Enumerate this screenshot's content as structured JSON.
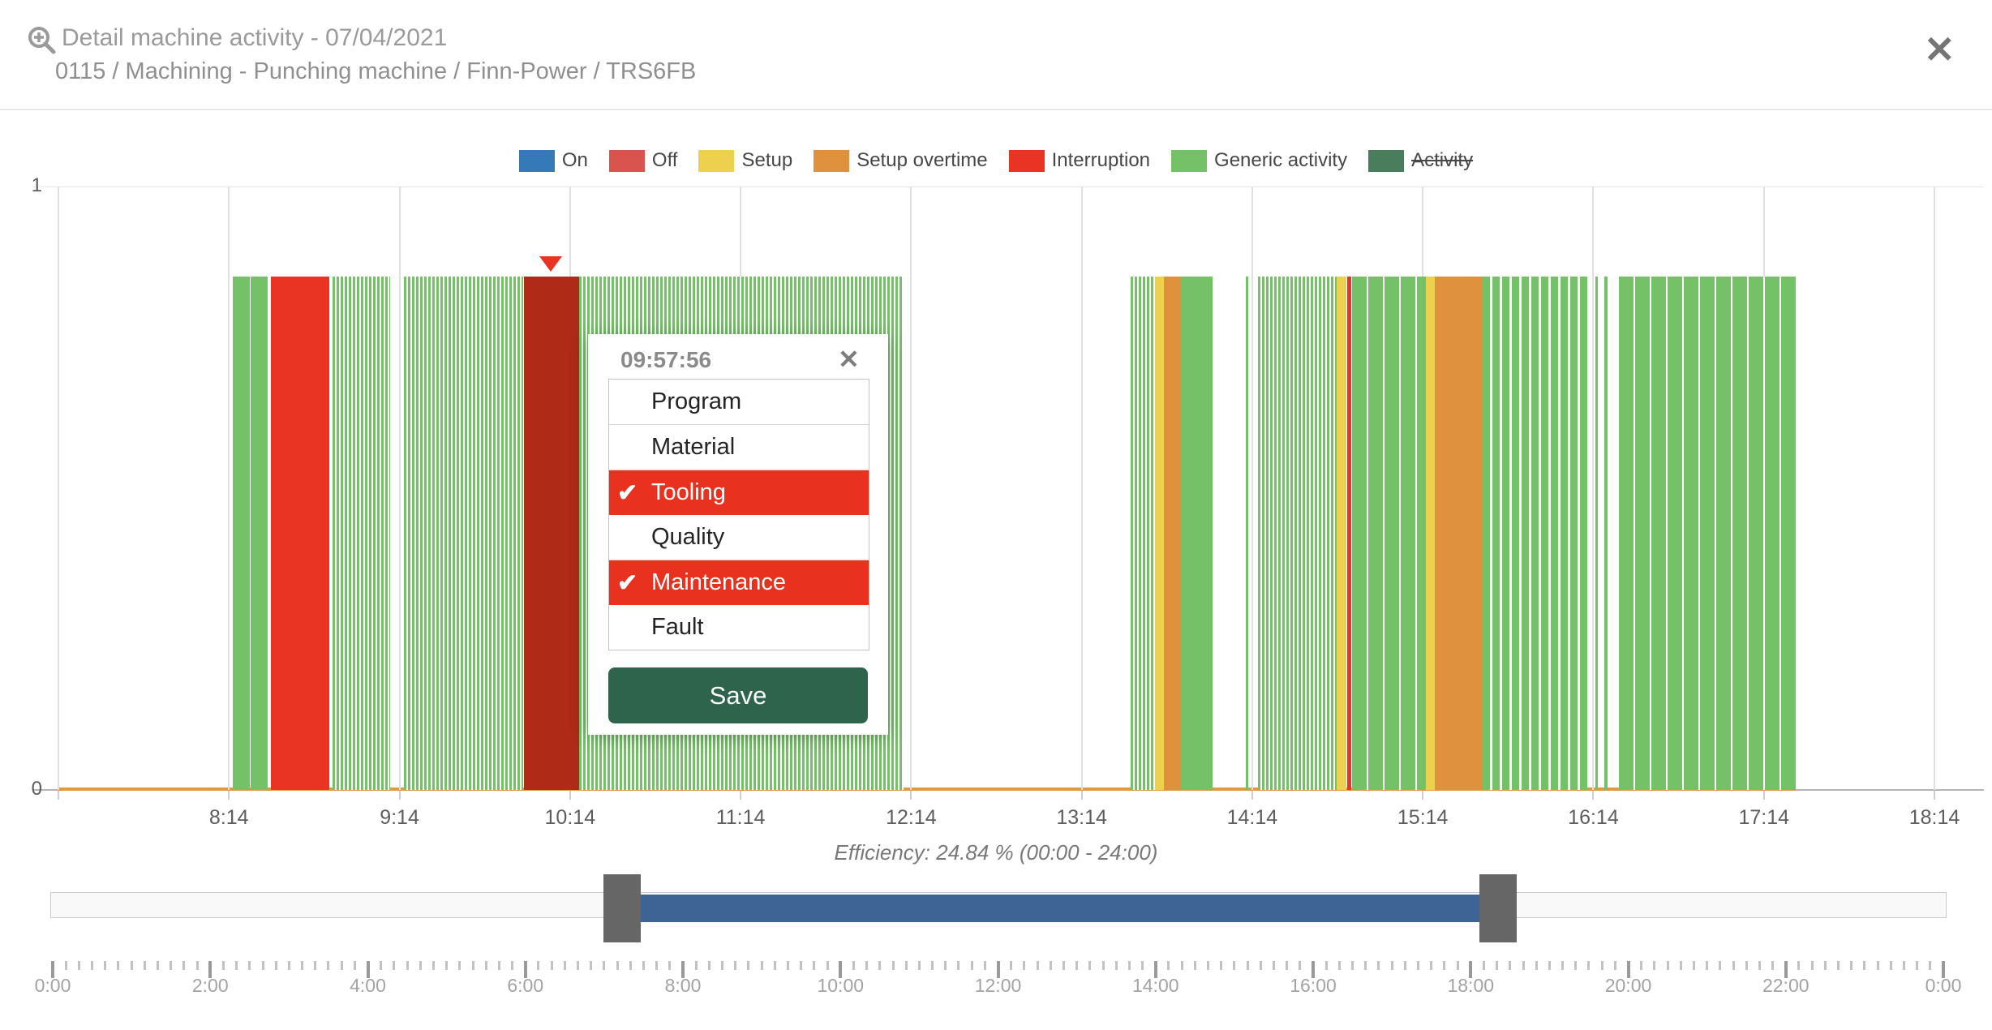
{
  "header": {
    "title": "Detail machine activity - 07/04/2021",
    "subtitle": "0115 / Machining - Punching machine / Finn-Power / TRS6FB",
    "close_glyph": "✕"
  },
  "legend": {
    "items": [
      {
        "label": "On",
        "color": "#3579b8",
        "struck": false
      },
      {
        "label": "Off",
        "color": "#d9534f",
        "struck": false
      },
      {
        "label": "Setup",
        "color": "#ecd04e",
        "struck": false
      },
      {
        "label": "Setup overtime",
        "color": "#e0913d",
        "struck": false
      },
      {
        "label": "Interruption",
        "color": "#e93323",
        "struck": false
      },
      {
        "label": "Generic activity",
        "color": "#74c167",
        "struck": false
      },
      {
        "label": "Activity",
        "color": "#4a7d5c",
        "struck": true
      }
    ]
  },
  "chart_data": {
    "type": "bar",
    "variant": "machine-activity-timeline",
    "title": "Detail machine activity - 07/04/2021",
    "x_start_hours": 7.2333,
    "x_end_hours": 18.2333,
    "x_ticks": [
      {
        "hours": 8.2333,
        "label": "8:14"
      },
      {
        "hours": 9.2333,
        "label": "9:14"
      },
      {
        "hours": 10.2333,
        "label": "10:14"
      },
      {
        "hours": 11.2333,
        "label": "11:14"
      },
      {
        "hours": 12.2333,
        "label": "12:14"
      },
      {
        "hours": 13.2333,
        "label": "13:14"
      },
      {
        "hours": 14.2333,
        "label": "14:14"
      },
      {
        "hours": 15.2333,
        "label": "15:14"
      },
      {
        "hours": 16.2333,
        "label": "16:14"
      },
      {
        "hours": 17.2333,
        "label": "17:14"
      },
      {
        "hours": 18.2333,
        "label": "18:14"
      }
    ],
    "y_ticks": [
      {
        "value": 1,
        "label": "1"
      },
      {
        "value": 0,
        "label": "0"
      }
    ],
    "bar_value": 0.85,
    "efficiency_caption": "Efficiency: 24.84 % (00:00 - 24:00)",
    "state_colors": {
      "on": "#3579b8",
      "off": "#d9534f",
      "setup": "#ecd04e",
      "setup_overtime": "#e0913d",
      "interruption": "#e93323",
      "interruption_selected": "#b02a18",
      "generic_activity": "#74c167",
      "activity": "#4a7d5c"
    },
    "baseline": {
      "color": "#e09a3f",
      "start_hours": 7.2333,
      "end_hours": 17.42
    },
    "marker": {
      "hours": 10.12,
      "color": "#e93323",
      "time_label": "09:57:56"
    },
    "segments": [
      {
        "state": "generic_activity",
        "start": 8.255,
        "end": 8.355,
        "pattern": "solid"
      },
      {
        "state": "generic_activity",
        "start": 8.362,
        "end": 8.46,
        "pattern": "solid"
      },
      {
        "state": "interruption",
        "start": 8.48,
        "end": 8.82,
        "pattern": "solid"
      },
      {
        "state": "generic_activity",
        "start": 8.84,
        "end": 9.18,
        "pattern": "striped-dense"
      },
      {
        "state": "generic_activity",
        "start": 9.26,
        "end": 9.96,
        "pattern": "striped-dense"
      },
      {
        "state": "interruption_selected",
        "start": 9.965,
        "end": 10.285,
        "pattern": "solid"
      },
      {
        "state": "generic_activity",
        "start": 10.285,
        "end": 12.19,
        "pattern": "striped-dense"
      },
      {
        "state": "generic_activity",
        "start": 13.52,
        "end": 13.665,
        "pattern": "striped-dense"
      },
      {
        "state": "setup",
        "start": 13.665,
        "end": 13.715,
        "pattern": "solid"
      },
      {
        "state": "setup_overtime",
        "start": 13.715,
        "end": 13.815,
        "pattern": "solid"
      },
      {
        "state": "generic_activity",
        "start": 13.815,
        "end": 14.0,
        "pattern": "solid"
      },
      {
        "state": "generic_activity",
        "start": 14.195,
        "end": 14.21,
        "pattern": "solid"
      },
      {
        "state": "generic_activity",
        "start": 14.265,
        "end": 14.73,
        "pattern": "striped-dense"
      },
      {
        "state": "setup",
        "start": 14.73,
        "end": 14.785,
        "pattern": "solid"
      },
      {
        "state": "interruption",
        "start": 14.79,
        "end": 14.815,
        "pattern": "solid"
      },
      {
        "state": "generic_activity",
        "start": 14.82,
        "end": 15.25,
        "pattern": "striped-wide"
      },
      {
        "state": "setup",
        "start": 15.25,
        "end": 15.305,
        "pattern": "solid"
      },
      {
        "state": "setup_overtime",
        "start": 15.305,
        "end": 15.585,
        "pattern": "solid"
      },
      {
        "state": "generic_activity",
        "start": 15.585,
        "end": 16.2,
        "pattern": "striped-med"
      },
      {
        "state": "generic_activity",
        "start": 16.245,
        "end": 16.26,
        "pattern": "solid"
      },
      {
        "state": "generic_activity",
        "start": 16.3,
        "end": 16.315,
        "pattern": "solid"
      },
      {
        "state": "generic_activity",
        "start": 16.385,
        "end": 17.42,
        "pattern": "striped-wide"
      }
    ]
  },
  "popup": {
    "title": "09:57:56",
    "close_glyph": "✕",
    "check_glyph": "✔",
    "selected_color": "#e8321f",
    "options": [
      {
        "label": "Program",
        "checked": false
      },
      {
        "label": "Material",
        "checked": false
      },
      {
        "label": "Tooling",
        "checked": true
      },
      {
        "label": "Quality",
        "checked": false
      },
      {
        "label": "Maintenance",
        "checked": true
      },
      {
        "label": "Fault",
        "checked": false
      }
    ],
    "save_label": "Save"
  },
  "slider": {
    "start_frac": 0.3015,
    "end_frac": 0.7635,
    "range_color": "#3d6494",
    "handle_color": "#666666"
  },
  "ruler": {
    "labels": [
      "0:00",
      "2:00",
      "4:00",
      "6:00",
      "8:00",
      "10:00",
      "12:00",
      "14:00",
      "16:00",
      "18:00",
      "20:00",
      "22:00",
      "0:00"
    ],
    "minor_per_major": 12
  }
}
